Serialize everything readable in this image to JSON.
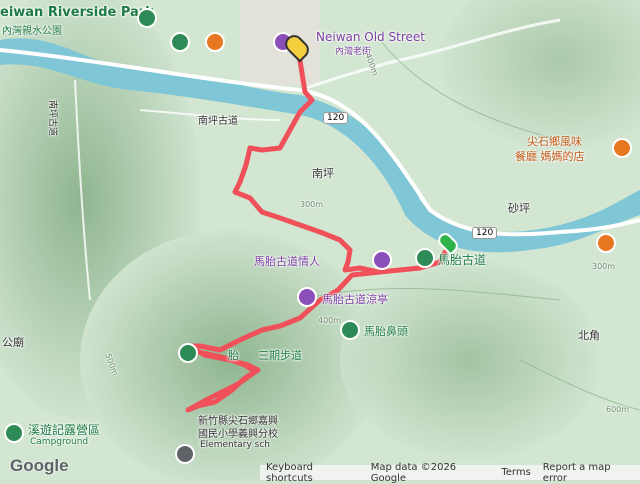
{
  "map": {
    "places": {
      "park_en": "eiwan Riverside Park",
      "park_zh": "內灣親水公園",
      "old_street_en": "Neiwan Old Street",
      "old_street_zh": "內灣老街",
      "nanping_road": "南坪古道",
      "nanping": "南坪",
      "road_120a": "120",
      "road_120b": "120",
      "shaping": "砂坪",
      "restaurant_line1": "尖石鄉風味",
      "restaurant_line2": "餐廳 媽媽的店",
      "matai_trail": "馬胎古道",
      "lovers_trail": "馬胎古道情人",
      "pavilion": "馬胎古道涼亭",
      "nose": "馬胎鼻頭",
      "beijiao": "北角",
      "gongmiao": "公廟",
      "camp_zh": "溪遊記露營區",
      "camp_en": "Campground",
      "school_zh1": "新竹縣尖石鄉嘉興",
      "school_zh2": "國民小學義興分校",
      "school_en": "Elementary sch",
      "trail_steps": "胎",
      "trail_steps2": "三期步道",
      "contour_400a": "400m",
      "contour_400b": "400m",
      "contour_300a": "300m",
      "contour_300b": "300m",
      "contour_500": "500m",
      "contour_600": "600m",
      "road_v": "南坪古道"
    },
    "colors": {
      "route": "#f0505a",
      "river": "#7fc6d6",
      "road": "#ffffff",
      "poi_green": "#2e8b57",
      "poi_purple": "#8a4fb8",
      "poi_orange": "#e87722"
    }
  },
  "footer": {
    "logo": "Google",
    "keyboard": "Keyboard shortcuts",
    "mapdata": "Map data ©2026 Google",
    "terms": "Terms",
    "report": "Report a map error"
  }
}
